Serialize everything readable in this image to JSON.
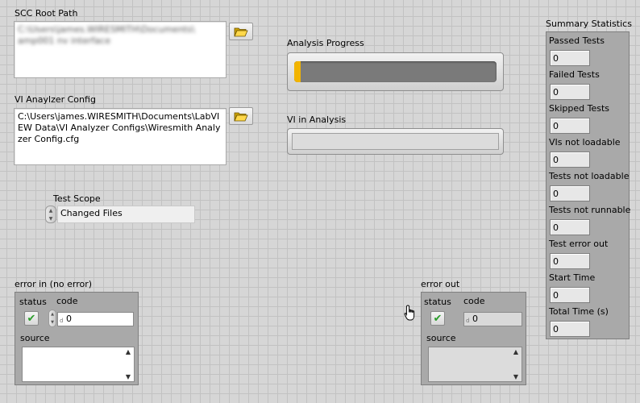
{
  "scc_root_path": {
    "label": "SCC Root Path",
    "value": "C:\\Users\\james.WIRESMITH\\Documents\\ amp001 nv interface"
  },
  "vi_analyzer_config": {
    "label": "VI Anaylzer Config",
    "value": "C:\\Users\\james.WIRESMITH\\Documents\\LabVIEW Data\\VI Analyzer Configs\\Wiresmith Analyzer Config.cfg"
  },
  "analysis_progress": {
    "label": "Analysis Progress",
    "fraction": 0.03,
    "colors": {
      "fill": "#f2b400",
      "track": "#7a7a7a"
    }
  },
  "vi_in_analysis": {
    "label": "VI in Analysis",
    "value": ""
  },
  "test_scope": {
    "label": "Test Scope",
    "selected": "Changed Files"
  },
  "error_in": {
    "label": "error in (no error)",
    "status_label": "status",
    "code_label": "code",
    "code_value": "0",
    "radix": "d",
    "source_label": "source",
    "source_value": ""
  },
  "error_out": {
    "label": "error out",
    "status_label": "status",
    "code_label": "code",
    "code_value": "0",
    "radix": "d",
    "source_label": "source",
    "source_value": ""
  },
  "summary": {
    "title": "Summary Statistics",
    "items": [
      {
        "label": "Passed Tests",
        "value": "0"
      },
      {
        "label": "Failed Tests",
        "value": "0"
      },
      {
        "label": "Skipped Tests",
        "value": "0"
      },
      {
        "label": "VIs not loadable",
        "value": "0"
      },
      {
        "label": "Tests not loadable",
        "value": "0"
      },
      {
        "label": "Tests not runnable",
        "value": "0"
      },
      {
        "label": "Test error out",
        "value": "0"
      },
      {
        "label": "Start Time",
        "value": "0"
      },
      {
        "label": "Total Time (s)",
        "value": "0"
      }
    ]
  },
  "icons": {
    "browse": "folder-open-icon",
    "status_ok": "checkmark-icon",
    "cursor": "hand-pointer-icon"
  }
}
